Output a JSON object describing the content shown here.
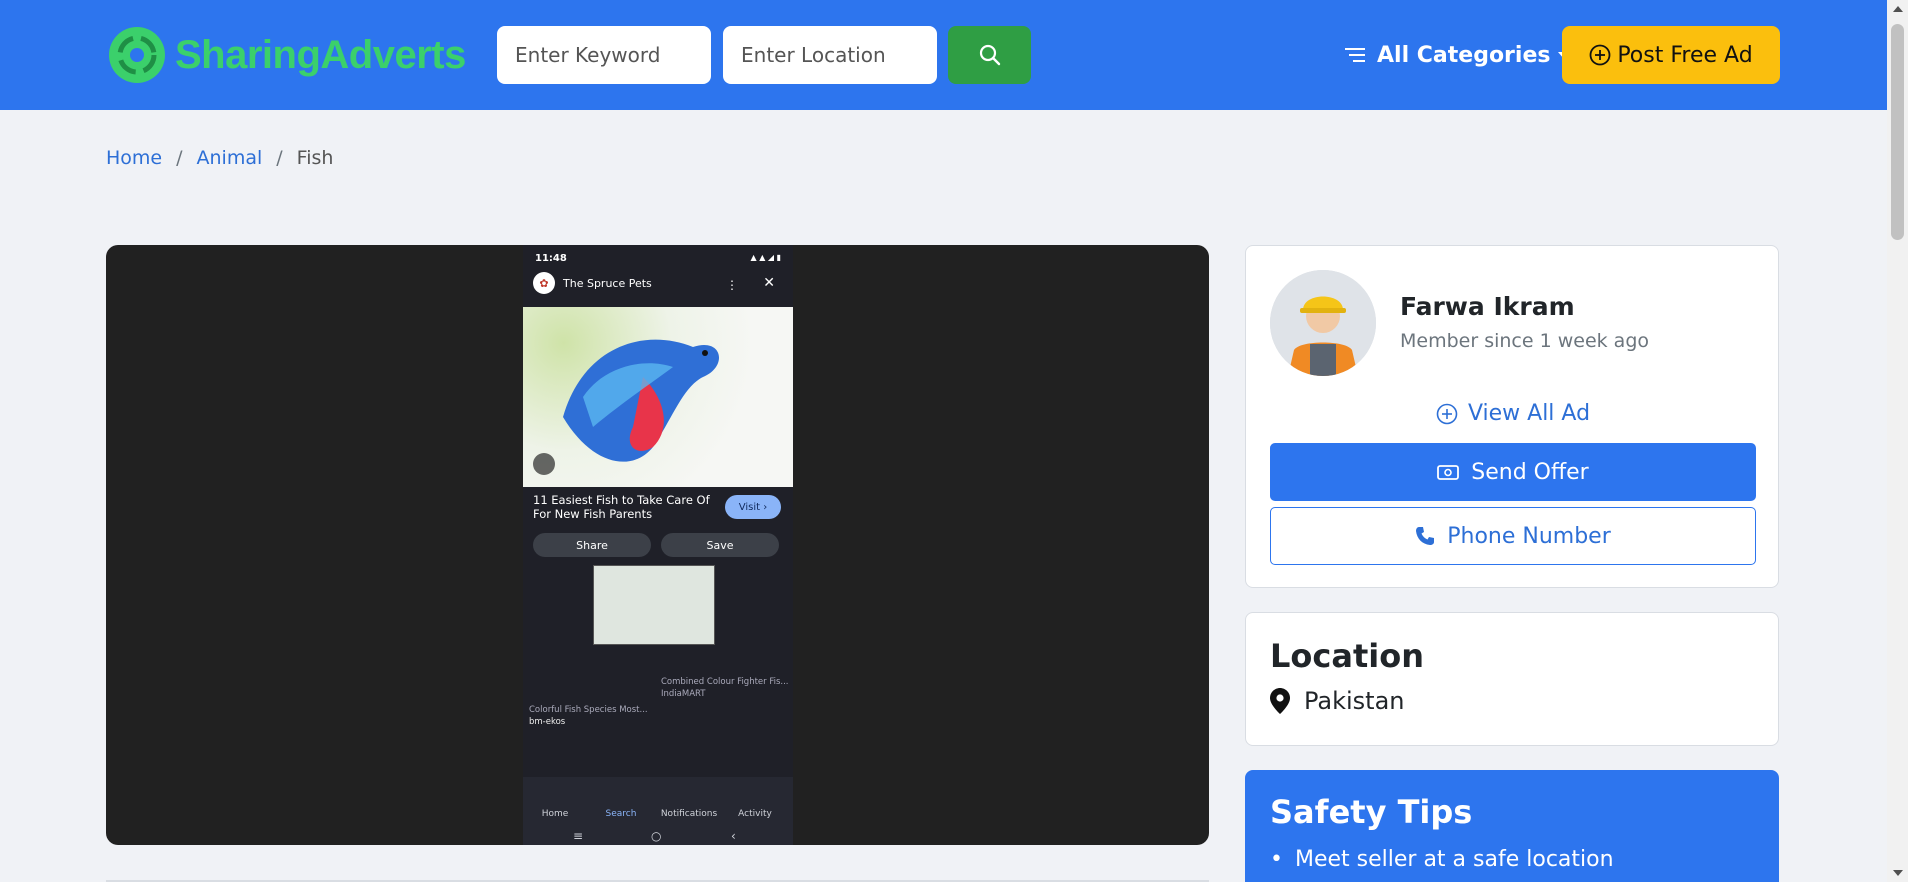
{
  "header": {
    "brand": {
      "part1": "Sharing",
      "part2": "Adverts"
    },
    "keyword_placeholder": "Enter Keyword",
    "location_placeholder": "Enter Location",
    "categories_label": "All Categories",
    "post_ad_label": "Post Free Ad",
    "colors": {
      "bar": "#2d75ee",
      "brand": "#3bd06b",
      "search": "#2f9e44",
      "post": "#fbbf0d"
    }
  },
  "breadcrumb": {
    "items": [
      "Home",
      "Animal"
    ],
    "current": "Fish"
  },
  "gallery": {
    "phone": {
      "time": "11:48",
      "source": "The Spruce Pets",
      "title": "11 Easiest Fish to Take Care Of For New Fish Parents",
      "visit": "Visit ›",
      "share": "Share",
      "save": "Save",
      "related1_title": "Colorful Fish Species Most...",
      "related1_source": "bm-ekos",
      "related2_title": "Combined Colour Fighter Fis...",
      "related2_source": "IndiaMART",
      "nav": [
        "Home",
        "Search",
        "Notifications",
        "Activity"
      ]
    }
  },
  "seller": {
    "name": "Farwa Ikram",
    "member_since": "Member since 1 week ago",
    "view_all": "View All Ad",
    "send_offer": "Send Offer",
    "phone_number": "Phone Number"
  },
  "location": {
    "title": "Location",
    "value": "Pakistan"
  },
  "safety": {
    "title": "Safety Tips",
    "tips": [
      "Meet seller at a safe location"
    ]
  }
}
